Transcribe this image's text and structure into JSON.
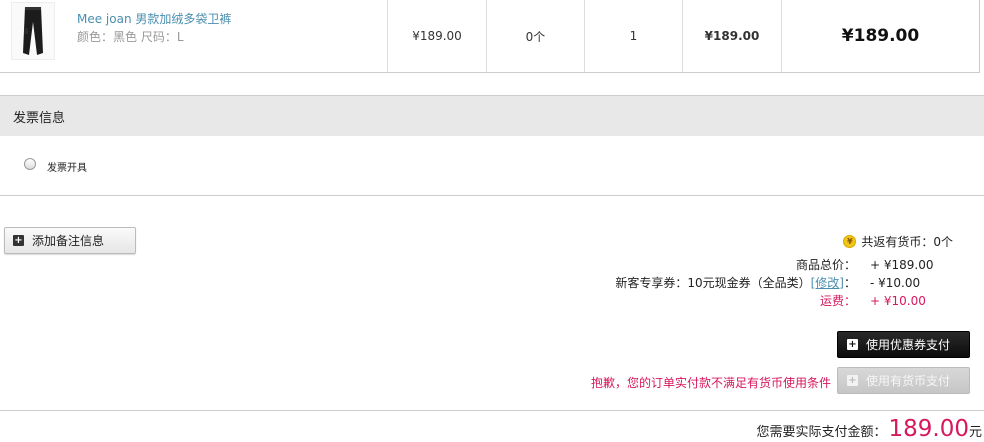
{
  "product": {
    "name": "Mee joan 男款加绒多袋卫裤",
    "attributes": "颜色：黑色 尺码：L",
    "price": "¥189.00",
    "coins": "0个",
    "quantity": "1",
    "subtotal": "¥189.00",
    "total": "¥189.00"
  },
  "invoice": {
    "title": "发票信息",
    "option_label": "发票开具"
  },
  "remark": {
    "button_label": "添加备注信息",
    "icon": "plus-icon"
  },
  "summary": {
    "coin_return": "共返有货币：0个",
    "goods_total_label": "商品总价：",
    "goods_total_value": "+ ¥189.00",
    "coupon_label": "新客专享券：10元现金券（全品类）",
    "coupon_modify": "[修改]",
    "coupon_colon": "：",
    "coupon_value": "- ¥10.00",
    "shipping_label": "运费：",
    "shipping_value": "+ ¥10.00"
  },
  "payment": {
    "coupon_pay_label": "使用优惠券支付",
    "coin_pay_label": "使用有货币支付",
    "coin_warning": "抱歉，您的订单实付款不满足有货币使用条件",
    "amount_label": "您需要实际支付金额：",
    "amount_value": "189.00",
    "amount_unit": "元"
  },
  "colors": {
    "accent_red": "#d6185d",
    "link_blue": "#4a8fb0",
    "coin_yellow": "#f2c619"
  }
}
